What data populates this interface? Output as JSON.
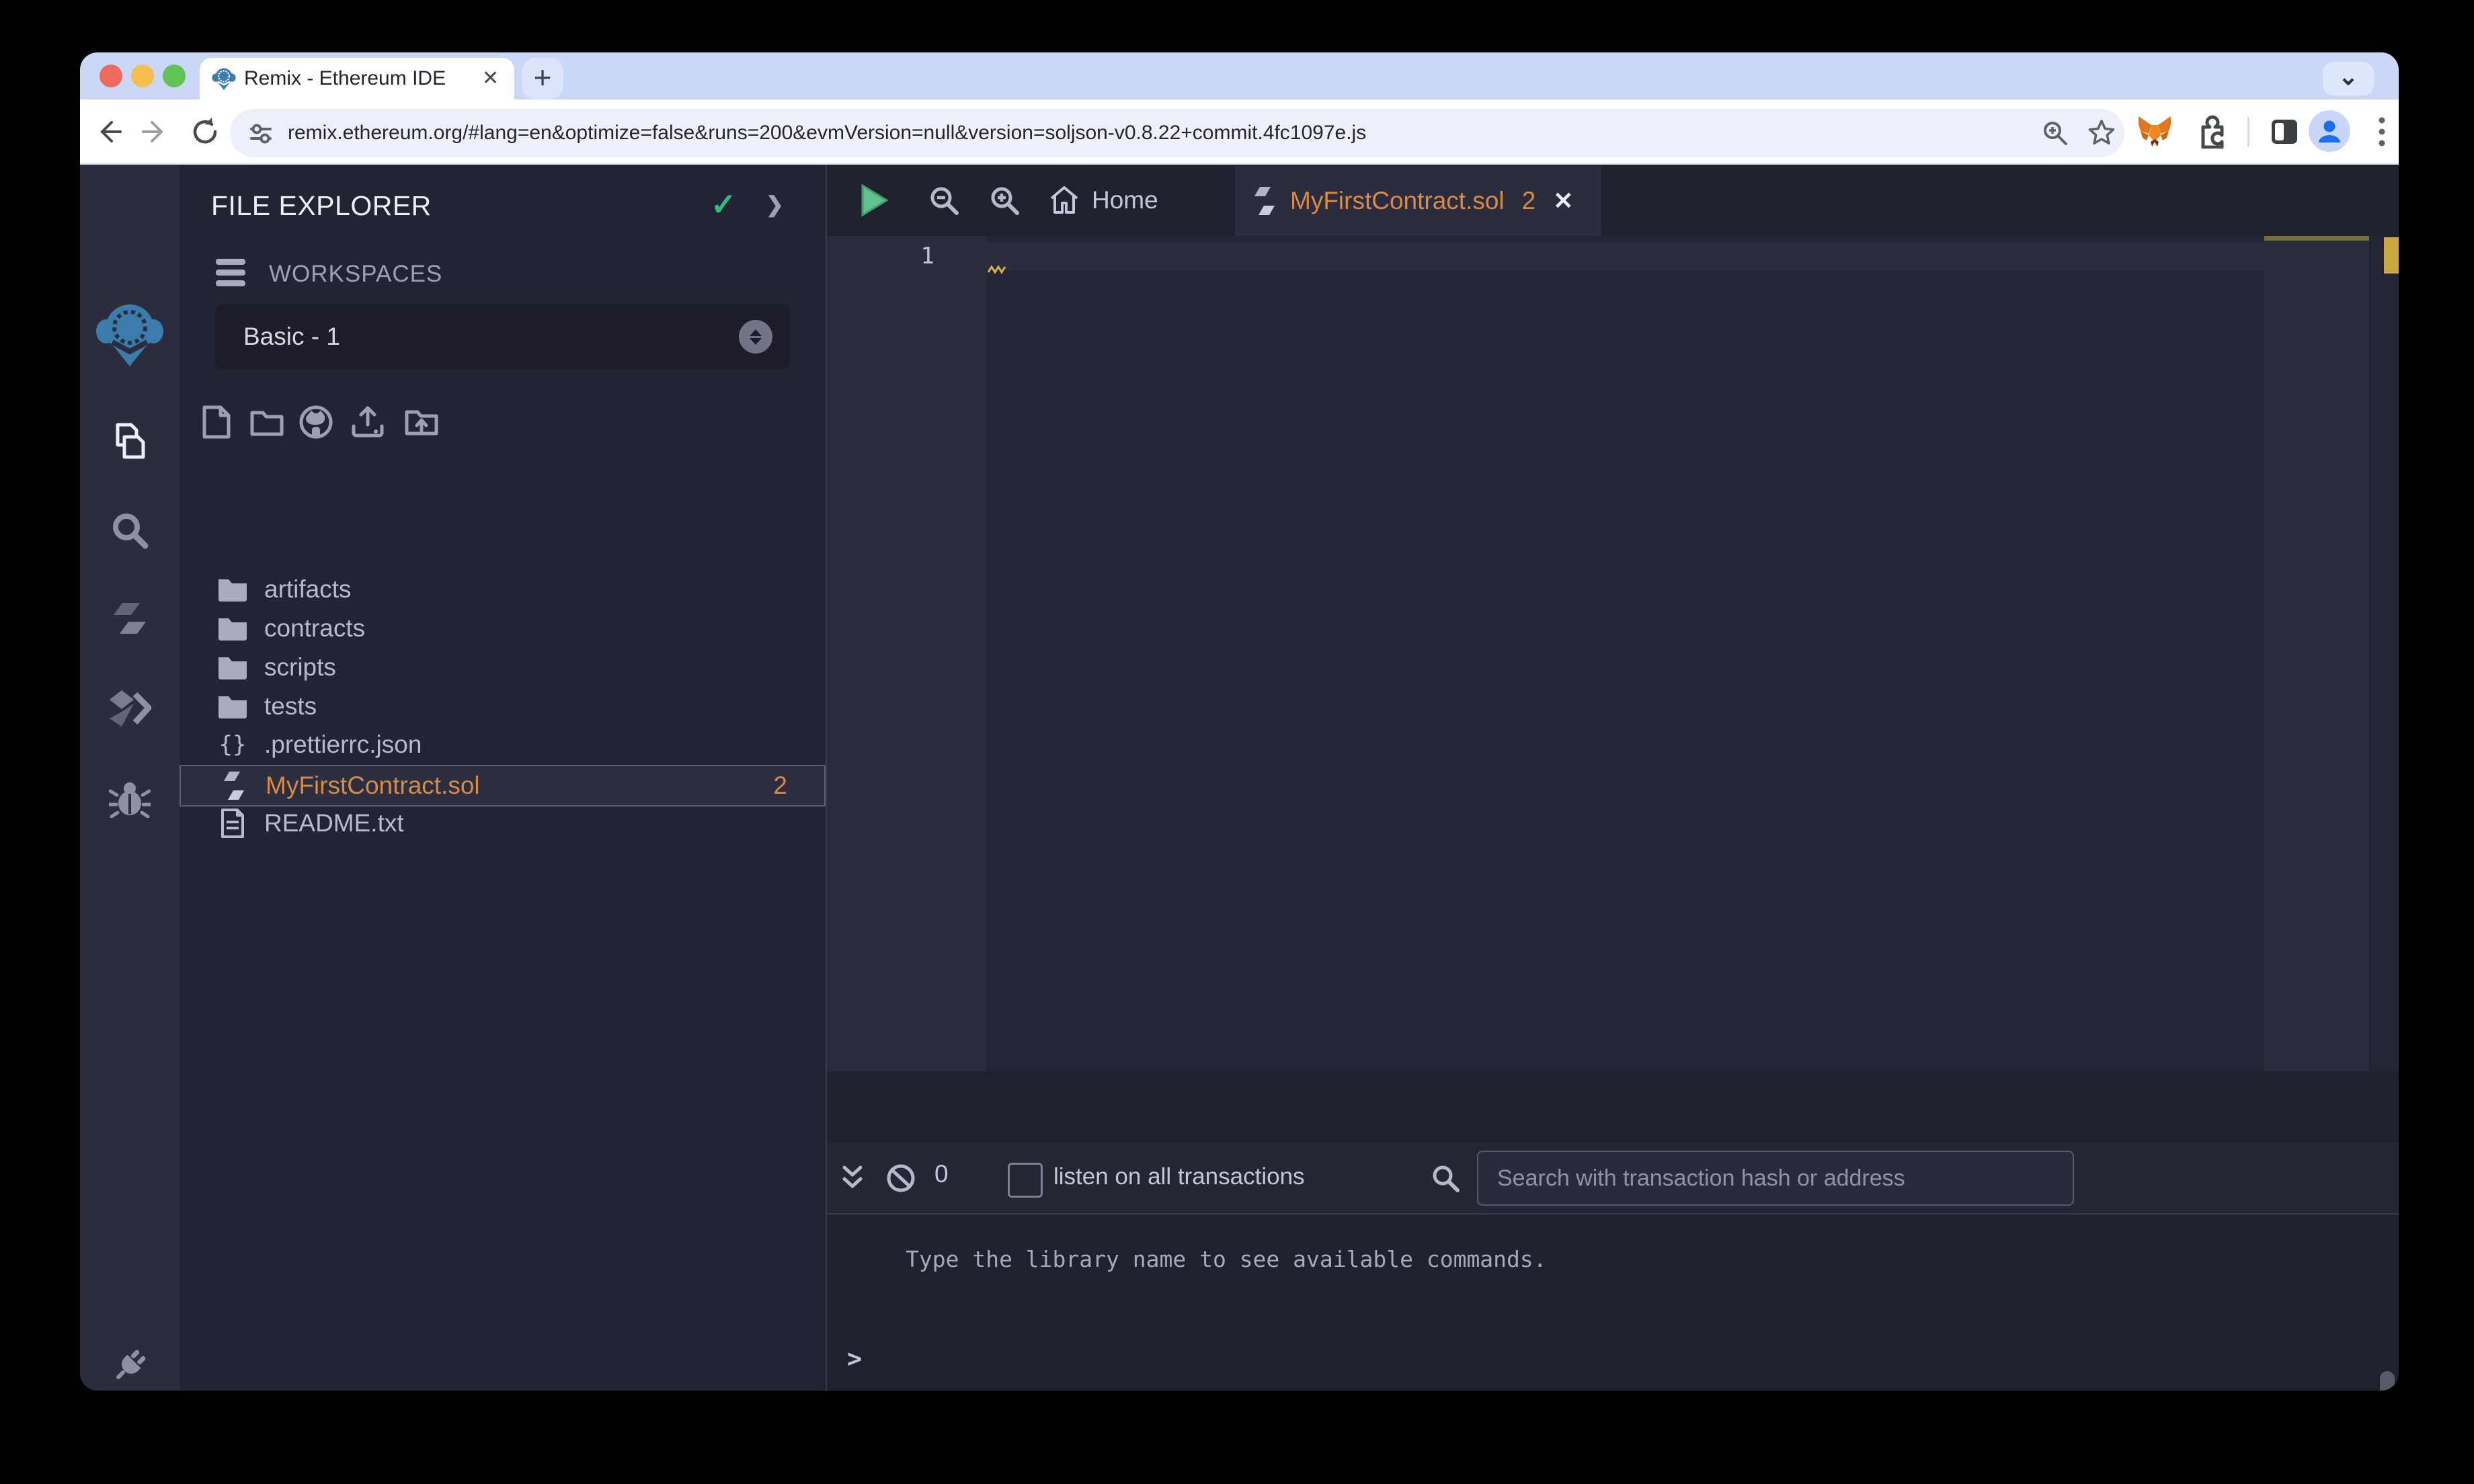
{
  "colors": {
    "traffic_red": "#ee6a5e",
    "traffic_yellow": "#f5bf4f",
    "traffic_green": "#61c354",
    "accent_orange": "#d98a44",
    "logo_blue": "#3a7dad",
    "check_green": "#35ba81",
    "play_green": "#62c28f",
    "warning_yellow": "#cba83d",
    "tabstrip_lavender": "#cbd7f7"
  },
  "browser": {
    "tab": {
      "title": "Remix - Ethereum IDE",
      "close": "✕"
    },
    "new_tab": "+",
    "tab_search": "⌄",
    "url": "remix.ethereum.org/#lang=en&optimize=false&runs=200&evmVersion=null&version=soljson-v0.8.22+commit.4fc1097e.js",
    "toolbar_icons": [
      "back-arrow",
      "forward-arrow",
      "reload",
      "site-settings",
      "zoom",
      "bookmark-star",
      "metamask-fox",
      "extensions-puzzle",
      "split-view",
      "profile-avatar",
      "kebab-menu"
    ]
  },
  "rail": {
    "items": [
      {
        "icon": "remix-logo"
      },
      {
        "icon": "file-explorer"
      },
      {
        "icon": "search"
      },
      {
        "icon": "solidity-compiler"
      },
      {
        "icon": "deploy-run"
      },
      {
        "icon": "debugger"
      },
      {
        "icon": "plugin-manager"
      },
      {
        "icon": "settings"
      }
    ]
  },
  "explorer": {
    "title": "FILE EXPLORER",
    "header_icons": [
      "check",
      "chevron-right"
    ],
    "check_glyph": "✓",
    "chevron_glyph": "❯",
    "workspaces_label": "WORKSPACES",
    "workspace_selected": "Basic - 1",
    "action_icons": [
      "new-file",
      "new-folder",
      "clone-github",
      "upload-file",
      "upload-folder"
    ],
    "files": [
      {
        "type": "folder",
        "name": "artifacts"
      },
      {
        "type": "folder",
        "name": "contracts"
      },
      {
        "type": "folder",
        "name": "scripts"
      },
      {
        "type": "folder",
        "name": "tests"
      },
      {
        "type": "json",
        "name": ".prettierrc.json",
        "icon_glyph": "{}"
      },
      {
        "type": "solidity",
        "name": "MyFirstContract.sol",
        "badge": "2",
        "selected": true
      },
      {
        "type": "text",
        "name": "README.txt"
      }
    ]
  },
  "editor": {
    "toolbar_icons": [
      "run-script-play",
      "zoom-out",
      "zoom-in"
    ],
    "tabs": [
      {
        "label": "Home",
        "icon": "home"
      },
      {
        "label": "MyFirstContract.sol",
        "icon": "solidity",
        "badge": "2",
        "close": "✕",
        "active": true
      }
    ],
    "line_number": "1"
  },
  "terminal": {
    "toolbar_icons": [
      "collapse-double-chevron",
      "block-transactions",
      "search"
    ],
    "count": "0",
    "listen_label": "listen on all transactions",
    "search_placeholder": "Search with transaction hash or address",
    "help_text": "Type the library name to see available commands.",
    "prompt": ">"
  }
}
